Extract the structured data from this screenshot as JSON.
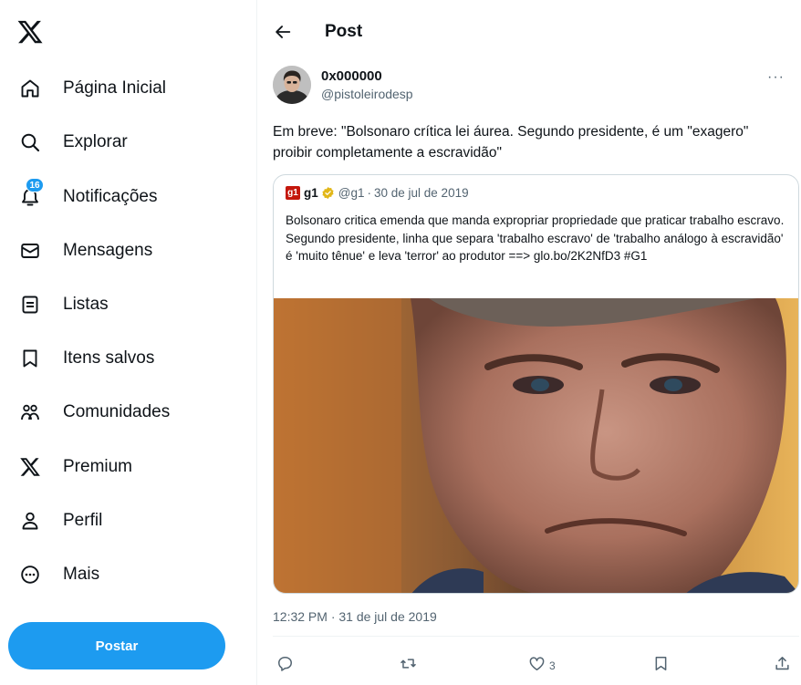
{
  "sidebar": {
    "items": [
      {
        "label": "Página Inicial",
        "icon": "home-icon"
      },
      {
        "label": "Explorar",
        "icon": "search-icon"
      },
      {
        "label": "Notificações",
        "icon": "bell-icon",
        "badge": "16"
      },
      {
        "label": "Mensagens",
        "icon": "mail-icon"
      },
      {
        "label": "Listas",
        "icon": "list-icon"
      },
      {
        "label": "Itens salvos",
        "icon": "bookmark-icon"
      },
      {
        "label": "Comunidades",
        "icon": "communities-icon"
      },
      {
        "label": "Premium",
        "icon": "x-logo-icon"
      },
      {
        "label": "Perfil",
        "icon": "person-icon"
      },
      {
        "label": "Mais",
        "icon": "more-circle-icon"
      }
    ],
    "post_button": "Postar"
  },
  "header": {
    "title": "Post"
  },
  "tweet": {
    "display_name": "0x000000",
    "handle": "@pistoleirodesp",
    "text": "Em breve: \"Bolsonaro crítica lei áurea. Segundo presidente, é um \"exagero\" proibir completamente a escravidão\"",
    "more": "···",
    "quote": {
      "logo": "g1",
      "name": "g1",
      "handle": "@g1",
      "separator": "·",
      "date": "30 de jul de 2019",
      "text": "Bolsonaro critica emenda que manda expropriar propriedade que praticar trabalho escravo. Segundo presidente, linha que separa 'trabalho escravo' de 'trabalho análogo à escravidão' é 'muito tênue' e leva 'terror' ao produtor ==> glo.bo/2K2NfD3 #G1"
    },
    "timestamp": "12:32 PM · 31 de jul de 2019",
    "actions": {
      "likes": "3"
    }
  },
  "colors": {
    "accent": "#1d9bf0",
    "secondary_text": "#536471",
    "border": "#cfd9de",
    "g1_red": "#c4170c",
    "verified_gold": "#e2b719"
  }
}
